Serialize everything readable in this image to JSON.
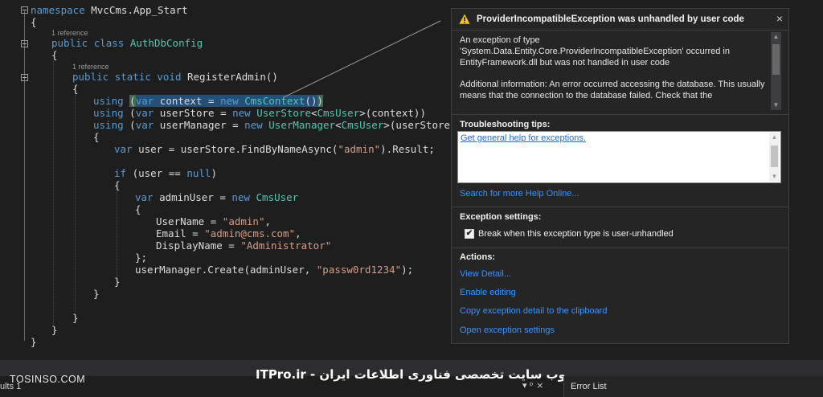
{
  "editor": {
    "refs": [
      "1 reference",
      "1 reference"
    ],
    "code": {
      "l1_kw": "namespace",
      "l1_rest": " MvcCms.App_Start",
      "open_brace": "{",
      "close_brace": "}",
      "l3_kw1": "public",
      "l3_kw2": "class",
      "l3_type": "AuthDbConfig",
      "l5_kw1": "public",
      "l5_kw2": "static",
      "l5_kw3": "void",
      "l5_rest": " RegisterAdmin()",
      "using": "using",
      "var": "var",
      "new": "new",
      "l7_a": " context = ",
      "l7_type": "CmsContext",
      "l7_paren": "()",
      "l7_close": ")",
      "l8_a": " userStore = ",
      "l8_type1": "UserStore",
      "l8_type2": "CmsUser",
      "l8_rest": ">(context))",
      "l9_a": " userManager = ",
      "l9_type1": "UserManager",
      "l9_rest": ">(userStore))",
      "l11_a": " user = userStore.FindByNameAsync(",
      "l11_str": "\"admin\"",
      "l11_rest": ").Result;",
      "l13_kw": "if",
      "l13_a": " (user == ",
      "l13_null": "null",
      "l13_rest": ")",
      "l15_a": " adminUser = ",
      "l15_type": "CmsUser",
      "l17_a": "UserName = ",
      "l17_str": "\"admin\"",
      "comma": ",",
      "l18_a": "Email = ",
      "l18_str": "\"admin@cms.com\"",
      "l19_a": "DisplayName = ",
      "l19_str": "\"Administrator\"",
      "l20": "};",
      "l21_a": "userManager.Create(adminUser, ",
      "l21_str": "\"passw0rd1234\"",
      "l21_rest": ");",
      "lt": "<"
    }
  },
  "popup": {
    "title": "ProviderIncompatibleException was unhandled by user code",
    "message_1": "An exception of type 'System.Data.Entity.Core.ProviderIncompatibleException' occurred in EntityFramework.dll but was not handled in user code",
    "message_2": "Additional information: An error occurred accessing the database. This usually means that the connection to the database failed. Check that the",
    "troubleshooting_heading": "Troubleshooting tips:",
    "tips_link": "Get general help for exceptions.",
    "search_help": "Search for more Help Online...",
    "exception_settings_heading": "Exception settings:",
    "break_checkbox_label": "Break when this exception type is user-unhandled",
    "break_checked": true,
    "actions_heading": "Actions:",
    "actions": [
      "View Detail...",
      "Enable editing",
      "Copy exception detail to the clipboard",
      "Open exception settings"
    ],
    "close_glyph": "×",
    "check_glyph": "✔",
    "warning_icon": "warning-triangle-icon"
  },
  "bottom": {
    "results_tab": "ults 1",
    "watermark_left": "TOSINSO.COM",
    "watermark_center": "ITPro.ir - وب سایت تخصصی فناوری اطلاعات ایران",
    "tab_icons": "▾ ᵖ ×",
    "error_list_tab": "Error List"
  },
  "colors": {
    "keyword": "#569cd6",
    "type": "#4ec9b0",
    "string": "#d69d85",
    "link": "#3794ff",
    "warning": "#f5c518"
  }
}
